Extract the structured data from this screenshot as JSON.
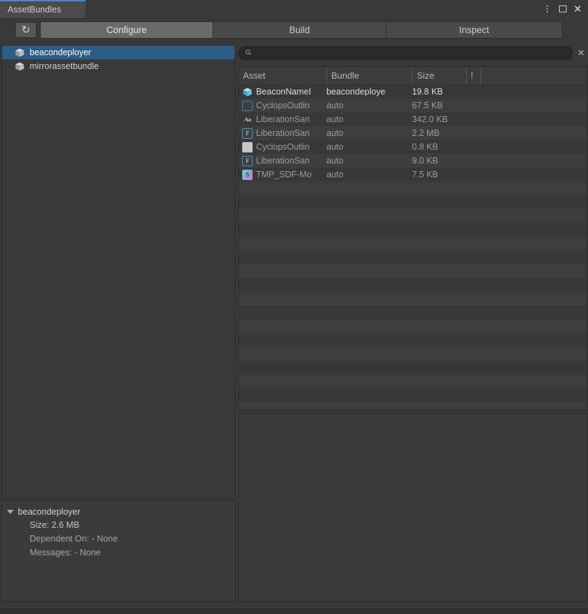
{
  "window": {
    "tab_label": "AssetBundles",
    "controls": {
      "menu_icon": "kebab-menu-icon",
      "maximize_icon": "maximize-icon",
      "close_icon": "close-icon"
    }
  },
  "toolbar": {
    "refresh_label": "↻",
    "tabs": [
      {
        "label": "Configure",
        "active": true
      },
      {
        "label": "Build",
        "active": false
      },
      {
        "label": "Inspect",
        "active": false
      }
    ]
  },
  "bundle_tree": {
    "items": [
      {
        "name": "beacondeployer",
        "selected": true,
        "icon": "bundle-package-icon"
      },
      {
        "name": "mirrorassetbundle",
        "selected": false,
        "icon": "bundle-package-icon"
      }
    ]
  },
  "bundle_detail": {
    "title": "beacondeployer",
    "size_line": "Size: 2.6 MB",
    "dependent_line": "Dependent On: - None",
    "messages_line": "Messages: - None"
  },
  "search": {
    "value": "",
    "placeholder": "",
    "icon": "search-icon",
    "clear_icon": "clear-icon"
  },
  "asset_table": {
    "columns": [
      "Asset",
      "Bundle",
      "Size",
      "!"
    ],
    "rows": [
      {
        "asset": "BeaconNameI",
        "bundle": "beacondeploye",
        "size": "19.8 KB",
        "flag": "",
        "icon": "prefab-icon"
      },
      {
        "asset": "CyclopsOutlin",
        "bundle": "auto",
        "size": "67.5 KB",
        "flag": "",
        "icon": "material-icon"
      },
      {
        "asset": "LiberationSan",
        "bundle": "auto",
        "size": "342.0 KB",
        "flag": "",
        "icon": "font-icon"
      },
      {
        "asset": "LiberationSan",
        "bundle": "auto",
        "size": "2.2 MB",
        "flag": "",
        "icon": "font-asset-icon"
      },
      {
        "asset": "CyclopsOutlin",
        "bundle": "auto",
        "size": "0.8 KB",
        "flag": "",
        "icon": "texture-icon"
      },
      {
        "asset": "LiberationSan",
        "bundle": "auto",
        "size": "9.0 KB",
        "flag": "",
        "icon": "font-asset-icon"
      },
      {
        "asset": "TMP_SDF-Mo",
        "bundle": "auto",
        "size": "7.5 KB",
        "flag": "",
        "icon": "shader-icon"
      }
    ]
  },
  "colors": {
    "background": "#393939",
    "panel": "#3b3b3b",
    "selection": "#2c5d87",
    "tab_accent": "#4a88cd",
    "row_alt": "#3e3e3e",
    "text": "#c8c8c8",
    "text_dim": "#9d9d9d"
  }
}
